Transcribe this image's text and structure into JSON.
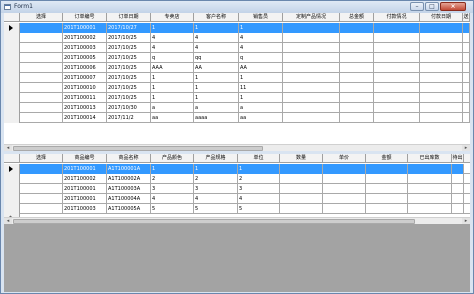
{
  "window": {
    "title": "Form1"
  },
  "grid1": {
    "columns": [
      "选择",
      "订单编号",
      "订单日期",
      "专卖店",
      "客户名称",
      "销售员",
      "定制产品情况",
      "总金额",
      "付款情况",
      "付款日期",
      "送"
    ],
    "rows": [
      [
        "201T100001",
        "2017/10/27",
        "1",
        "1",
        "1",
        "",
        "",
        "",
        "",
        ""
      ],
      [
        "201T100002",
        "2017/10/25",
        "4",
        "4",
        "4",
        "",
        "",
        "",
        "",
        ""
      ],
      [
        "201T100003",
        "2017/10/25",
        "4",
        "4",
        "4",
        "",
        "",
        "",
        "",
        ""
      ],
      [
        "201T100005",
        "2017/10/25",
        "q",
        "qq",
        "q",
        "",
        "",
        "",
        "",
        ""
      ],
      [
        "201T100006",
        "2017/10/25",
        "AAA",
        "AA",
        "AA",
        "",
        "",
        "",
        "",
        ""
      ],
      [
        "201T100007",
        "2017/10/25",
        "1",
        "1",
        "1",
        "",
        "",
        "",
        "",
        ""
      ],
      [
        "201T100010",
        "2017/10/25",
        "1",
        "1",
        "11",
        "",
        "",
        "",
        "",
        ""
      ],
      [
        "201T100011",
        "2017/10/25",
        "1",
        "1",
        "1",
        "",
        "",
        "",
        "",
        ""
      ],
      [
        "201T100013",
        "2017/10/30",
        "a",
        "a",
        "a",
        "",
        "",
        "",
        "",
        ""
      ],
      [
        "201T100014",
        "2017/11/2",
        "aa",
        "aaaa",
        "aa",
        "",
        "",
        "",
        "",
        ""
      ]
    ]
  },
  "grid2": {
    "columns": [
      "选择",
      "商品编号",
      "商品名称",
      "产品颜色",
      "产品规格",
      "单位",
      "数量",
      "单价",
      "金额",
      "已出库数",
      "待出"
    ],
    "rows": [
      [
        "201T100001",
        "A1T100001A",
        "1",
        "1",
        "1",
        "",
        "",
        "",
        "",
        ""
      ],
      [
        "201T100002",
        "A1T100002A",
        "2",
        "2",
        "2",
        "",
        "",
        "",
        "",
        ""
      ],
      [
        "201T100001",
        "A1T100003A",
        "3",
        "3",
        "3",
        "",
        "",
        "",
        "",
        ""
      ],
      [
        "201T100001",
        "A1T100004A",
        "4",
        "4",
        "4",
        "",
        "",
        "",
        "",
        ""
      ],
      [
        "201T100003",
        "A1T100005A",
        "5",
        "5",
        "5",
        "",
        "",
        "",
        "",
        ""
      ]
    ]
  },
  "icons": {
    "current_row": "arrow-right-icon",
    "new_row": "asterisk-icon"
  }
}
